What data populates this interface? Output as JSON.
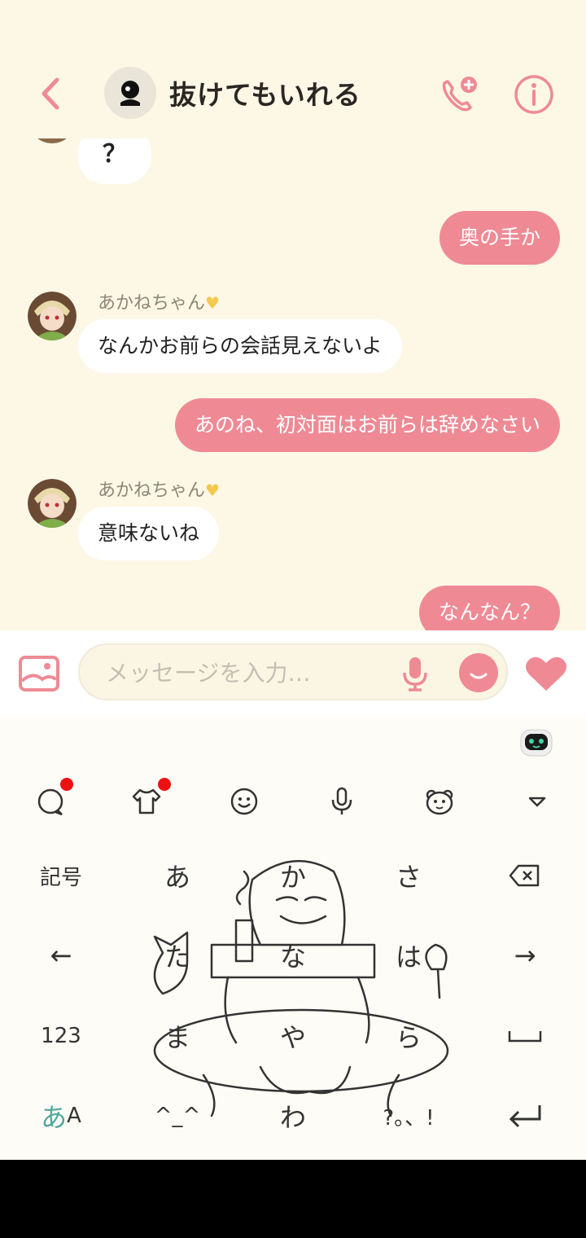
{
  "header": {
    "title": "抜けてもいれる",
    "back_icon": "chevron-left-icon",
    "call_icon": "phone-plus-icon",
    "info_icon": "info-circle-icon",
    "accent_color": "#ef8a95"
  },
  "chat": {
    "messages": [
      {
        "side": "in",
        "text": "？"
      },
      {
        "side": "out",
        "text": "奥の手か"
      },
      {
        "side": "in",
        "sender": "あかねちゃん",
        "text": "なんかお前らの会話見えないよ"
      },
      {
        "side": "out",
        "text": "あのね、初対面はお前らは辞めなさい"
      },
      {
        "side": "in",
        "sender": "あかねちゃん",
        "text": "意味ないね"
      },
      {
        "side": "out",
        "text": "なんなん？"
      }
    ]
  },
  "input": {
    "placeholder": "メッセージを入力…"
  },
  "keyboard": {
    "toolbar": [
      "chat-bubble-icon",
      "shirt-icon",
      "smiley-icon",
      "mic-icon",
      "bear-icon",
      "triangle-down-icon"
    ],
    "rows": [
      [
        "記号",
        "あ",
        "か",
        "さ",
        "⌫"
      ],
      [
        "←",
        "た",
        "な",
        "は",
        "→"
      ],
      [
        "123",
        "ま",
        "や",
        "ら",
        "␣"
      ],
      [
        "あA",
        "^_^",
        "わ",
        "?。、!",
        "↵"
      ]
    ]
  }
}
